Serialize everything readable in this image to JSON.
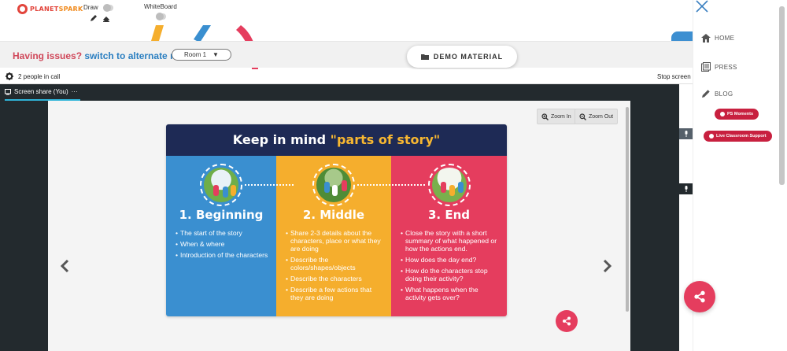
{
  "header": {
    "logo_text_1": "PLANET",
    "logo_text_2": "SPARK",
    "draw_label": "Draw",
    "whiteboard_label": "WhiteBoard"
  },
  "banner": {
    "issue_text": "Having issues?",
    "alt_text": "switch to alternate room",
    "room_selected": "Room 1",
    "room_caret": "▼"
  },
  "demo_button": {
    "label": "DEMO MATERIAL"
  },
  "call": {
    "people_text": "2 people in call",
    "stop_share": "Stop screen"
  },
  "share": {
    "tab_label": "Screen share (You)",
    "tab_menu": "···",
    "zoom_in": "Zoom In",
    "zoom_out": "Zoom Out"
  },
  "slide": {
    "title_pre": "Keep in mind ",
    "title_highlight": "\"parts of story\"",
    "columns": [
      {
        "title": "1. Beginning",
        "points": [
          "The start of the story",
          "When & where",
          "Introduction of the characters"
        ]
      },
      {
        "title": "2. Middle",
        "points": [
          "Share 2-3 details about the characters, place or what they are doing",
          "Describe the colors/shapes/objects",
          "Describe the characters",
          "Describe a few actions that they are doing"
        ]
      },
      {
        "title": "3. End",
        "points": [
          "Close the story with a short summary of what happened or how the actions end.",
          "How does the day end?",
          "How do the characters stop doing their activity?",
          "What happens when the activity gets over?"
        ]
      }
    ]
  },
  "sidebar": {
    "items": [
      {
        "label": "HOME",
        "icon": "home-icon"
      },
      {
        "label": "PRESS",
        "icon": "press-icon"
      },
      {
        "label": "BLOG",
        "icon": "pencil-icon"
      }
    ],
    "ps_moments": "PS Moments",
    "live_support": "Live Classroom Support"
  },
  "colors": {
    "accent_red": "#e53d5e",
    "link_blue": "#2b7fc1",
    "slide_navy": "#1e2a55",
    "col_blue": "#3a8fd0",
    "col_yellow": "#f5ae2d",
    "col_pink": "#e53d5e"
  }
}
